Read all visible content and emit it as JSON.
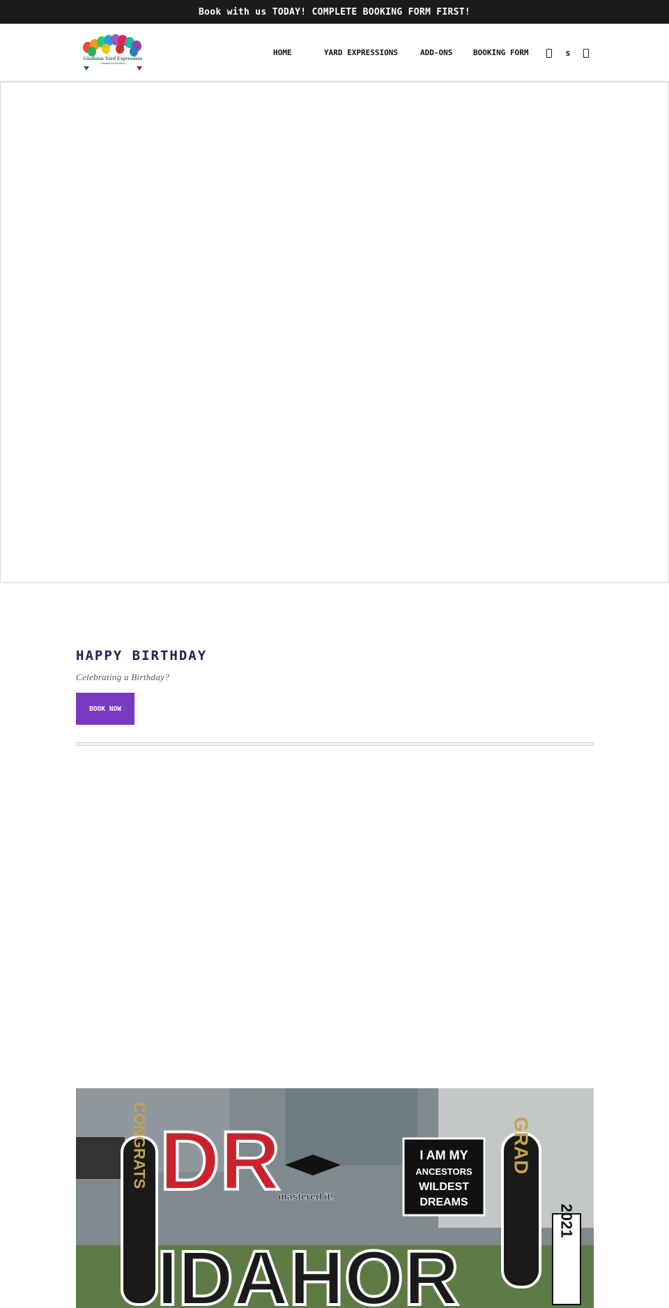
{
  "announcement": {
    "text": "Book with us TODAY! COMPLETE BOOKING FORM FIRST!"
  },
  "header": {
    "logo": {
      "brand": "Gladiator Yard Expressions",
      "tagline": "Committed to Excellence"
    },
    "nav": [
      {
        "label": "HOME"
      },
      {
        "label": "YARD EXPRESSIONS"
      },
      {
        "label": "ADD-ONS"
      },
      {
        "label": "BOOKING FORM"
      }
    ],
    "icons": {
      "account": {
        "icon": "user-icon"
      },
      "currency": {
        "icon": "currency-icon",
        "label": "s"
      },
      "cart": {
        "icon": "cart-icon"
      }
    }
  },
  "section": {
    "title": "HAPPY BIRTHDAY",
    "subtitle": "Celebrating a Birthday?",
    "button_label": "BOOK NOW",
    "accent_color": "#7b38c0",
    "title_color": "#2a1c4e"
  },
  "photo": {
    "signs": {
      "left_panel": "CONGRATS",
      "main_top": "DR",
      "main_bottom": "IDAHOR",
      "cap_text": "mastered it!",
      "box_line1": "I AM MY",
      "box_line2": "ANCESTORS",
      "box_line3": "WILDEST",
      "box_line4": "DREAMS",
      "right_panel": "GRAD",
      "year": "2021"
    }
  }
}
